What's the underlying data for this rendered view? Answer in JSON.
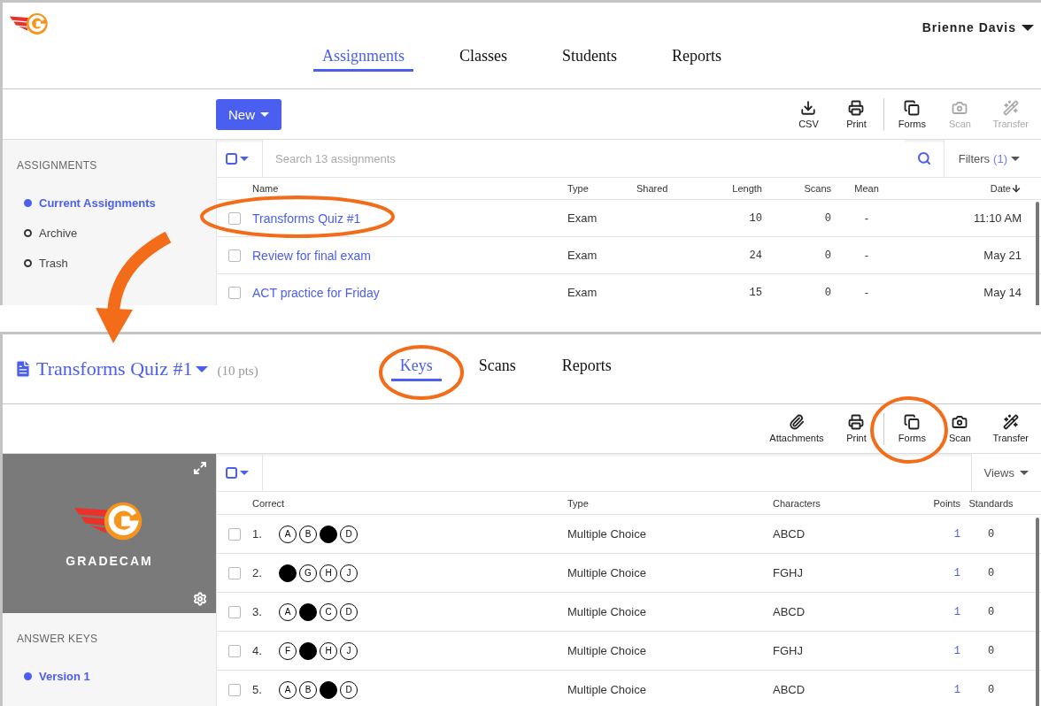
{
  "top": {
    "user": "Brienne Davis",
    "nav": [
      {
        "label": "Assignments",
        "selected": true
      },
      {
        "label": "Classes",
        "selected": false
      },
      {
        "label": "Students",
        "selected": false
      },
      {
        "label": "Reports",
        "selected": false
      }
    ],
    "new_button": "New",
    "tools": [
      {
        "label": "CSV",
        "disabled": false
      },
      {
        "label": "Print",
        "disabled": false
      },
      {
        "label": "Forms",
        "disabled": false
      },
      {
        "label": "Scan",
        "disabled": true
      },
      {
        "label": "Transfer",
        "disabled": true
      }
    ],
    "sidebar": {
      "heading": "ASSIGNMENTS",
      "items": [
        {
          "label": "Current Assignments",
          "selected": true
        },
        {
          "label": "Archive",
          "selected": false
        },
        {
          "label": "Trash",
          "selected": false
        }
      ]
    },
    "select_all": {
      "checked": false
    },
    "search": {
      "placeholder": "Search 13 assignments"
    },
    "filters": {
      "label": "Filters",
      "count": "(1)"
    },
    "columns": [
      "Name",
      "Type",
      "Shared",
      "Length",
      "Scans",
      "Mean",
      "Date"
    ],
    "rows": [
      {
        "checked": false,
        "name": "Transforms Quiz #1",
        "type": "Exam",
        "length": "10",
        "scans": "0",
        "mean": "-",
        "date": "11:10 AM"
      },
      {
        "checked": false,
        "name": "Review for final exam",
        "type": "Exam",
        "length": "24",
        "scans": "0",
        "mean": "-",
        "date": "May 21"
      },
      {
        "checked": false,
        "name": "ACT practice for Friday",
        "type": "Exam",
        "length": "15",
        "scans": "0",
        "mean": "-",
        "date": "May 14"
      }
    ]
  },
  "bottom": {
    "title": "Transforms Quiz #1",
    "points": "(10 pts)",
    "tabs": [
      {
        "label": "Keys",
        "selected": true
      },
      {
        "label": "Scans",
        "selected": false
      },
      {
        "label": "Reports",
        "selected": false
      }
    ],
    "tools": [
      {
        "label": "Attachments",
        "disabled": false
      },
      {
        "label": "Print",
        "disabled": false
      },
      {
        "label": "Forms",
        "disabled": false
      },
      {
        "label": "Scan",
        "disabled": false
      },
      {
        "label": "Transfer",
        "disabled": false
      }
    ],
    "brand": "GRADECAM",
    "sidebar": {
      "heading": "ANSWER KEYS",
      "items": [
        {
          "label": "Version 1",
          "selected": true
        }
      ]
    },
    "select_all": {
      "checked": false
    },
    "views": "Views",
    "columns": [
      "Correct",
      "Type",
      "Characters",
      "Points",
      "Standards"
    ],
    "rows": [
      {
        "checked": false,
        "number": "1.",
        "choices": [
          {
            "filled": false,
            "letter": "A"
          },
          {
            "filled": false,
            "letter": "B"
          },
          {
            "filled": true
          },
          {
            "filled": false,
            "letter": "D"
          }
        ],
        "type": "Multiple Choice",
        "characters": "ABCD",
        "points": "1",
        "standards": "0"
      },
      {
        "checked": false,
        "number": "2.",
        "choices": [
          {
            "filled": true
          },
          {
            "filled": false,
            "letter": "G"
          },
          {
            "filled": false,
            "letter": "H"
          },
          {
            "filled": false,
            "letter": "J"
          }
        ],
        "type": "Multiple Choice",
        "characters": "FGHJ",
        "points": "1",
        "standards": "0"
      },
      {
        "checked": false,
        "number": "3.",
        "choices": [
          {
            "filled": false,
            "letter": "A"
          },
          {
            "filled": true
          },
          {
            "filled": false,
            "letter": "C"
          },
          {
            "filled": false,
            "letter": "D"
          }
        ],
        "type": "Multiple Choice",
        "characters": "ABCD",
        "points": "1",
        "standards": "0"
      },
      {
        "checked": false,
        "number": "4.",
        "choices": [
          {
            "filled": false,
            "letter": "F"
          },
          {
            "filled": true
          },
          {
            "filled": false,
            "letter": "H"
          },
          {
            "filled": false,
            "letter": "J"
          }
        ],
        "type": "Multiple Choice",
        "characters": "FGHJ",
        "points": "1",
        "standards": "0"
      },
      {
        "checked": false,
        "number": "5.",
        "choices": [
          {
            "filled": false,
            "letter": "A"
          },
          {
            "filled": false,
            "letter": "B"
          },
          {
            "filled": true
          },
          {
            "filled": false,
            "letter": "D"
          }
        ],
        "type": "Multiple Choice",
        "characters": "ABCD",
        "points": "1",
        "standards": "0"
      }
    ]
  }
}
